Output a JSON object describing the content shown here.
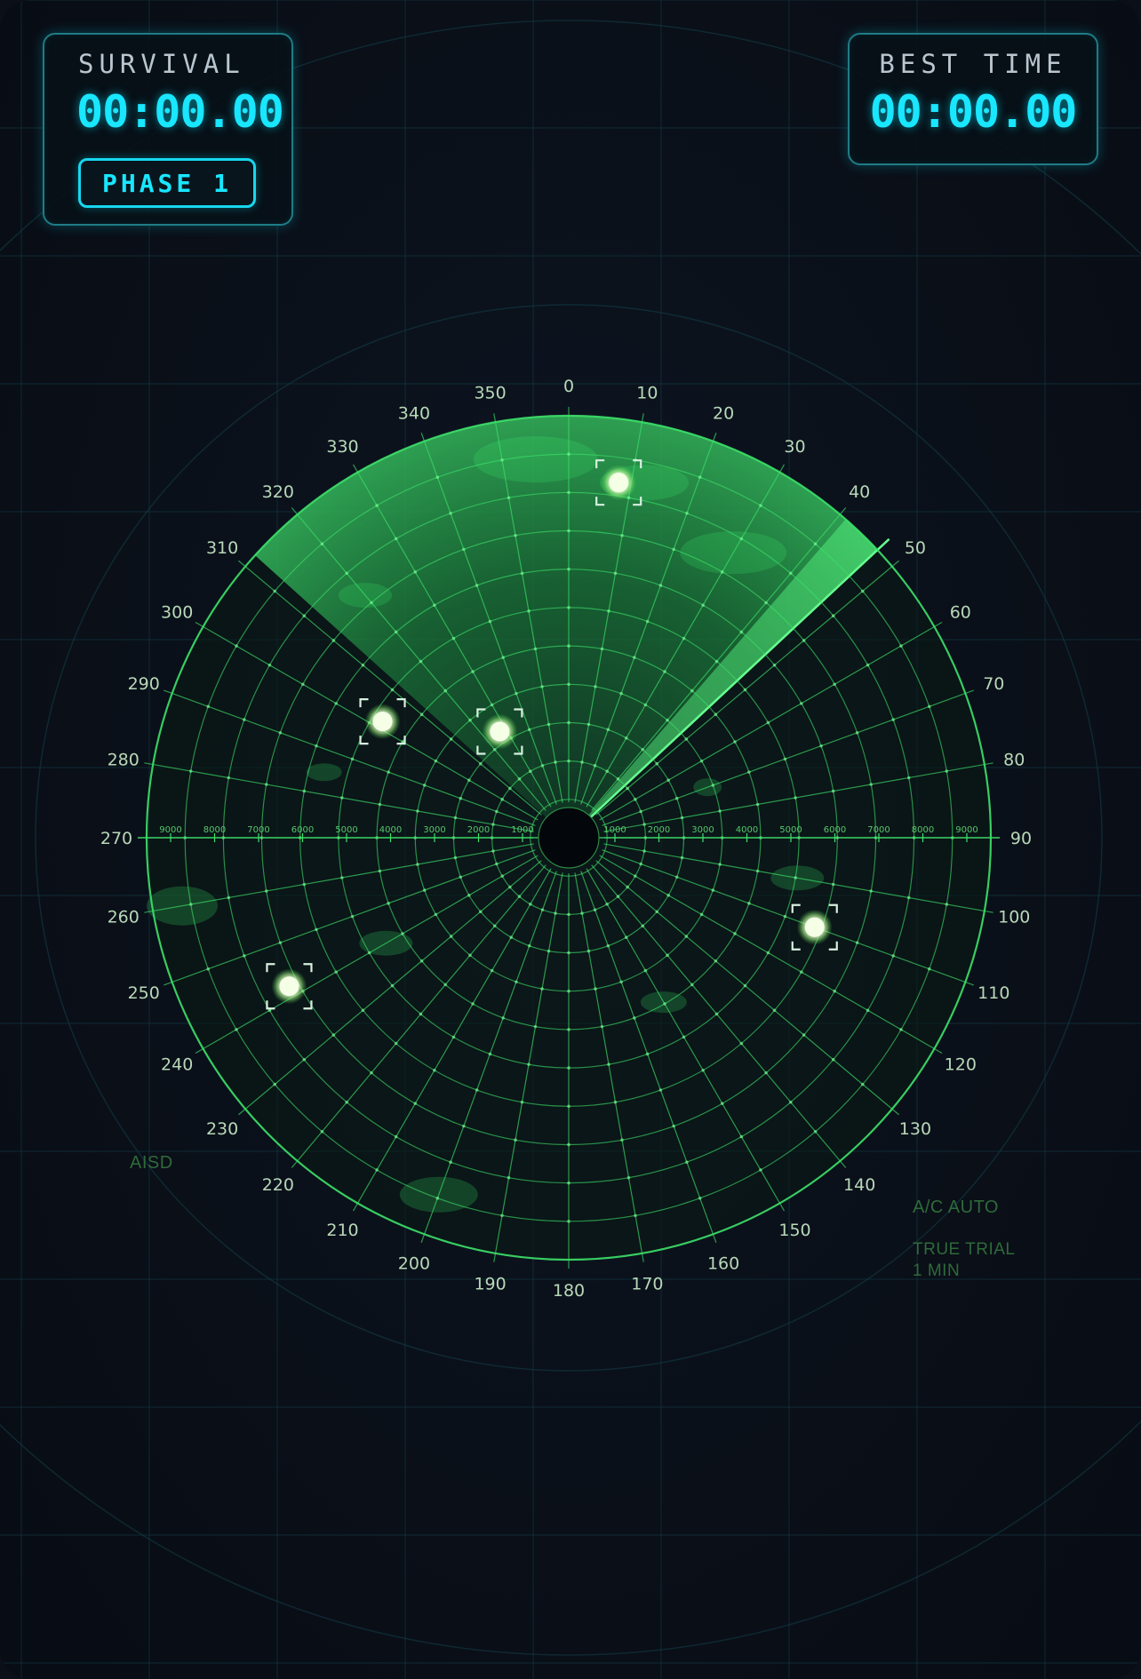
{
  "hud": {
    "survival": {
      "label": "SURVIVAL",
      "time": "00:00.00",
      "phase": "PHASE 1"
    },
    "best": {
      "label": "BEST TIME",
      "time": "00:00.00"
    }
  },
  "radar": {
    "bearing_labels": [
      "0",
      "10",
      "20",
      "30",
      "40",
      "50",
      "60",
      "70",
      "80",
      "90",
      "100",
      "110",
      "120",
      "130",
      "140",
      "150",
      "160",
      "170",
      "180",
      "190",
      "200",
      "210",
      "220",
      "230",
      "240",
      "250",
      "260",
      "270",
      "280",
      "290",
      "300",
      "310",
      "320",
      "330",
      "340",
      "350"
    ],
    "range_labels": [
      "1000",
      "2000",
      "3000",
      "4000",
      "5000",
      "6000",
      "7000",
      "8000",
      "9000"
    ],
    "sweep_bearing_deg": 47,
    "status_text": {
      "left": "AISD",
      "right_1": "A/C AUTO",
      "right_2": "TRUE TRIAL",
      "right_3": "1 MIN"
    },
    "targets": [
      {
        "bearing_deg": 8,
        "range_fraction": 0.85
      },
      {
        "bearing_deg": 302,
        "range_fraction": 0.52
      },
      {
        "bearing_deg": 327,
        "range_fraction": 0.3
      },
      {
        "bearing_deg": 110,
        "range_fraction": 0.62
      },
      {
        "bearing_deg": 242,
        "range_fraction": 0.75
      }
    ]
  },
  "colors": {
    "radar_green": "#3de26a",
    "hud_cyan": "#19e6ff",
    "background": "#0a0f18"
  }
}
